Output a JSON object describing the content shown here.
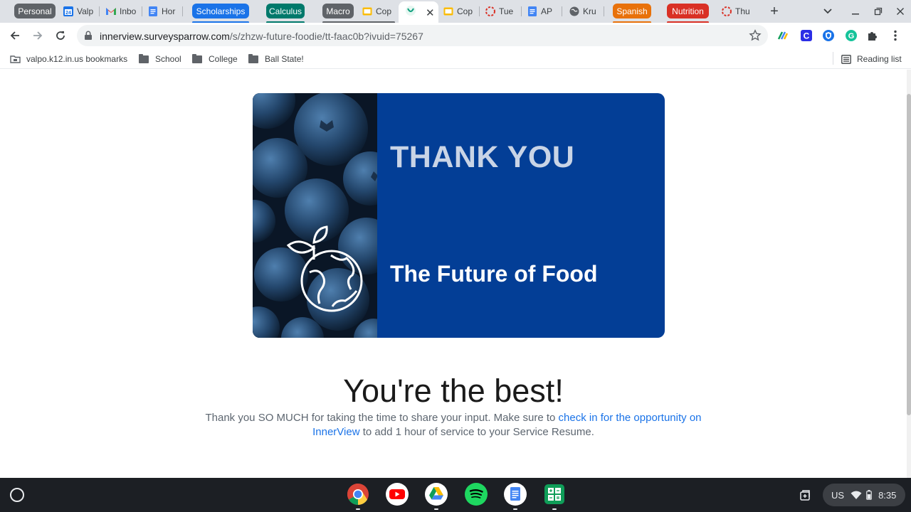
{
  "browser": {
    "tabs": {
      "personal": "Personal",
      "valpo": "Valp",
      "inbox": "Inbo",
      "home": "Hor",
      "scholarships": "Scholarships",
      "calculus": "Calculus",
      "macro": "Macro",
      "copy1": "Cop",
      "copy2": "Cop",
      "tue": "Tue",
      "ap": "AP",
      "kru": "Kru",
      "spanish": "Spanish",
      "nutrition": "Nutrition",
      "thu": "Thu"
    },
    "group_colors": {
      "personal": "#5f6368",
      "scholarships": "#1a73e8",
      "calculus": "#00796b",
      "macro": "#5f6368",
      "spanish": "#e8710a",
      "nutrition": "#d93025"
    },
    "url_host": "innerview.surveysparrow.com",
    "url_path": "/s/zhzw-future-foodie/tt-faac0b?ivuid=75267"
  },
  "bookmarks": {
    "items": [
      "valpo.k12.in.us bookmarks",
      "School",
      "College",
      "Ball State!"
    ],
    "reading_list": "Reading list"
  },
  "page": {
    "banner_title": "THANK YOU",
    "banner_subtitle": "The Future of Food",
    "headline": "You're the best!",
    "message_start": "Thank you SO MUCH for taking the time to share your input. Make sure to ",
    "message_link": "check in for the opportunity on InnerView",
    "message_end": " to add 1 hour of service to your Service Resume."
  },
  "shelf": {
    "apps": [
      "chrome-icon",
      "youtube-icon",
      "google-drive-icon",
      "spotify-icon",
      "google-docs-icon",
      "google-sheets-icon"
    ],
    "locale": "US",
    "time": "8:35"
  }
}
